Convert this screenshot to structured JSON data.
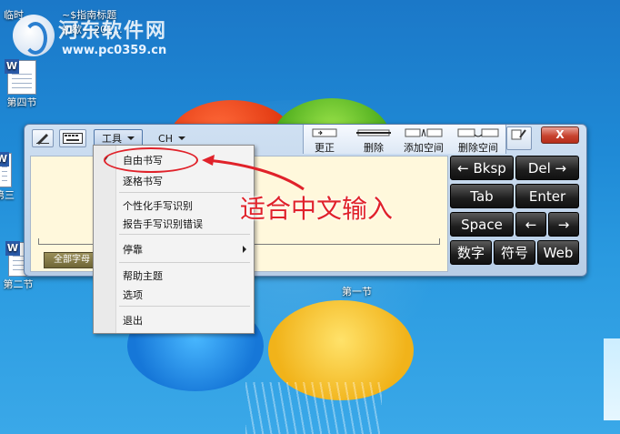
{
  "desktop": {
    "top_icon_label_1": "临时",
    "top_doc_title_line1": "~$指南标题",
    "top_doc_title_line2": "初歇~-201...",
    "watermark_title": "河东软件网",
    "watermark_url": "www.pc0359.cn",
    "icon_1_label": "第四节",
    "icon_2_label": "第三",
    "icon_3_label": "第二节",
    "word_letter": "W"
  },
  "tip": {
    "tools_label": "工具",
    "lang_label": "CH",
    "edit_buttons": [
      {
        "label": "更正"
      },
      {
        "label": "删除"
      },
      {
        "label": "添加空间"
      },
      {
        "label": "删除空间"
      }
    ],
    "help_label": "?",
    "close_label": "X",
    "all_chars_label": "全部字母",
    "section_label": "第一节",
    "keys": {
      "bksp": "← Bksp",
      "del": "Del →",
      "tab": "Tab",
      "enter": "Enter",
      "space": "Space",
      "left": "←",
      "right": "→",
      "num": "数字",
      "sym": "符号",
      "web": "Web"
    }
  },
  "menu": {
    "checked_mark": "✓",
    "items": [
      {
        "label": "自由书写"
      },
      {
        "label": "逐格书写"
      },
      {
        "label": "个性化手写识别"
      },
      {
        "label": "报告手写识别错误"
      },
      {
        "label": "停靠"
      },
      {
        "label": "帮助主题"
      },
      {
        "label": "选项"
      },
      {
        "label": "退出"
      }
    ]
  },
  "annotation": {
    "text": "适合中文输入",
    "color": "#e0222a"
  }
}
